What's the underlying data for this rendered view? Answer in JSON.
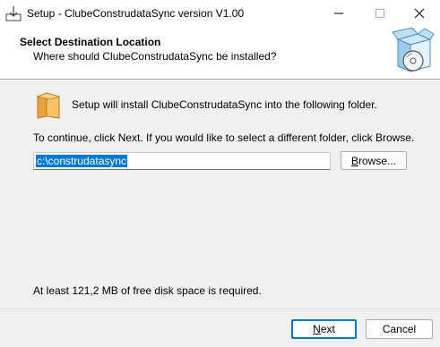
{
  "window": {
    "title": "Setup - ClubeConstrudataSync version V1.00"
  },
  "header": {
    "title": "Select Destination Location",
    "subtitle": "Where should ClubeConstrudataSync be installed?"
  },
  "content": {
    "intro": "Setup will install ClubeConstrudataSync into the following folder.",
    "instruction": "To continue, click Next. If you would like to select a different folder, click Browse.",
    "path_value": "c:\\construdatasync",
    "browse_label_accel": "B",
    "browse_label_rest": "rowse...",
    "disk_space": "At least 121,2 MB of free disk space is required."
  },
  "footer": {
    "next_label_accel": "N",
    "next_label_rest": "ext",
    "cancel_label": "Cancel"
  },
  "colors": {
    "accent": "#0078d7",
    "background": "#f0f0f0"
  }
}
